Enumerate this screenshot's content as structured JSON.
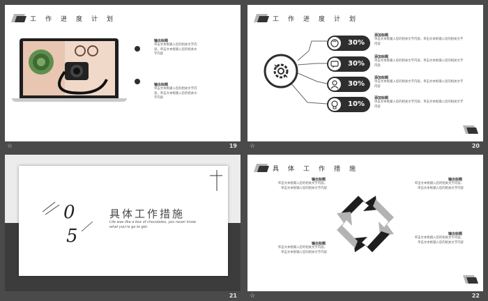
{
  "slides": [
    {
      "number": "19",
      "title": "工作进度计划",
      "items": [
        {
          "title": "输出标题",
          "text": "单击文本框输入您的相关文字内容，单击文本框输入您的相关文字内容"
        },
        {
          "title": "输出标题",
          "text": "单击文本框输入您的相关文字内容，单击文本框输入您的相关文字内容"
        }
      ]
    },
    {
      "number": "20",
      "title": "工作进度计划",
      "percents": [
        "30%",
        "30%",
        "30%",
        "10%"
      ],
      "items": [
        {
          "title": "添加标题",
          "text": "单击文本框输入您的相关文字内容，单击文本框输入您的相关文字内容"
        },
        {
          "title": "添加标题",
          "text": "单击文本框输入您的相关文字内容，单击文本框输入您的相关文字内容"
        },
        {
          "title": "添加标题",
          "text": "单击文本框输入您的相关文字内容，单击文本框输入您的相关文字内容"
        },
        {
          "title": "添加标题",
          "text": "单击文本框输入您的相关文字内容，单击文本框输入您的相关文字内容"
        }
      ]
    },
    {
      "number": "21",
      "section_number_1": "0",
      "section_number_2": "5",
      "section_title": "具体工作措施",
      "subtitle": "Life was like a box of chocolates, you never know what you're go to get."
    },
    {
      "number": "22",
      "title": "具体工作措施",
      "items": [
        {
          "title": "输出标题",
          "text": "单击文本框输入您的相关文字内容，单击文本框输入您的相关文字内容"
        },
        {
          "title": "输出标题",
          "text": "单击文本框输入您的相关文字内容，单击文本框输入您的相关文字内容"
        },
        {
          "title": "输出标题",
          "text": "单击文本框输入您的相关文字内容，单击文本框输入您的相关文字内容"
        },
        {
          "title": "输出标题",
          "text": "单击文本框输入您的相关文字内容，单击文本框输入您的相关文字内容"
        }
      ]
    }
  ],
  "icons": [
    "slide-star-icon",
    "gear-icon",
    "brain-icon",
    "chat-icon",
    "person-icon",
    "lightbulb-icon",
    "cycle-arrows-icon"
  ],
  "colors": {
    "background": "#4a4a4a",
    "dark": "#2e2e2e",
    "gray": "#b3b3b3",
    "text": "#333333"
  }
}
